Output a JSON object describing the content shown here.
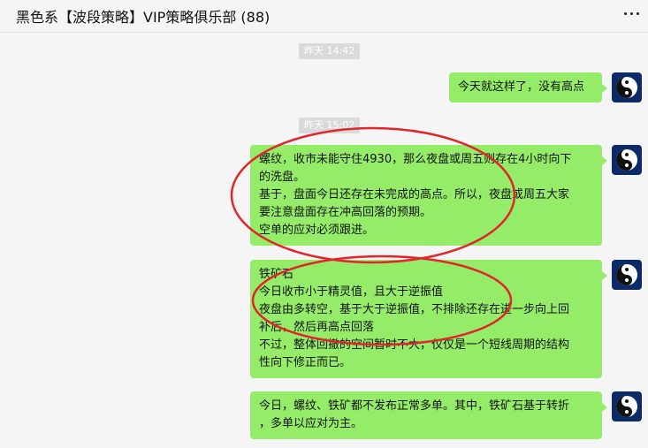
{
  "header": {
    "title": "黑色系【波段策略】VIP策略俱乐部  (88)",
    "menu_icon": "more-dots-icon"
  },
  "timestamps": [
    "昨天 14:42",
    "昨天 15:02"
  ],
  "messages": [
    {
      "sender": "self",
      "avatar_icon": "yin-yang-icon",
      "lines": [
        "今天就这样了，没有高点"
      ]
    },
    {
      "sender": "self",
      "avatar_icon": "yin-yang-icon",
      "lines": [
        "螺纹，收市未能守住4930，那么夜盘或周五则存在4小时向下",
        "的洗盘。",
        "基于，盘面今日还存在未完成的高点。所以，夜盘或周五大家",
        "要注意盘面存在冲高回落的预期。",
        "空单的应对必须跟进。"
      ]
    },
    {
      "sender": "self",
      "avatar_icon": "yin-yang-icon",
      "lines": [
        "铁矿石",
        "今日收市小于精灵值，且大于逆振值",
        "夜盘由多转空，基于大于逆振值，不排除还存在进一步向上回",
        "补后，然后再高点回落",
        "不过，整体回撤的空间暂时不大，仅仅是一个短线周期的结构",
        "性向下修正而已。"
      ]
    },
    {
      "sender": "self",
      "avatar_icon": "yin-yang-icon",
      "lines": [
        "今日，螺纹、铁矿都不发布正常多单。其中，铁矿石基于转折",
        "，多单以应对为主。"
      ]
    }
  ],
  "annotations": {
    "color": "#e0262b"
  }
}
